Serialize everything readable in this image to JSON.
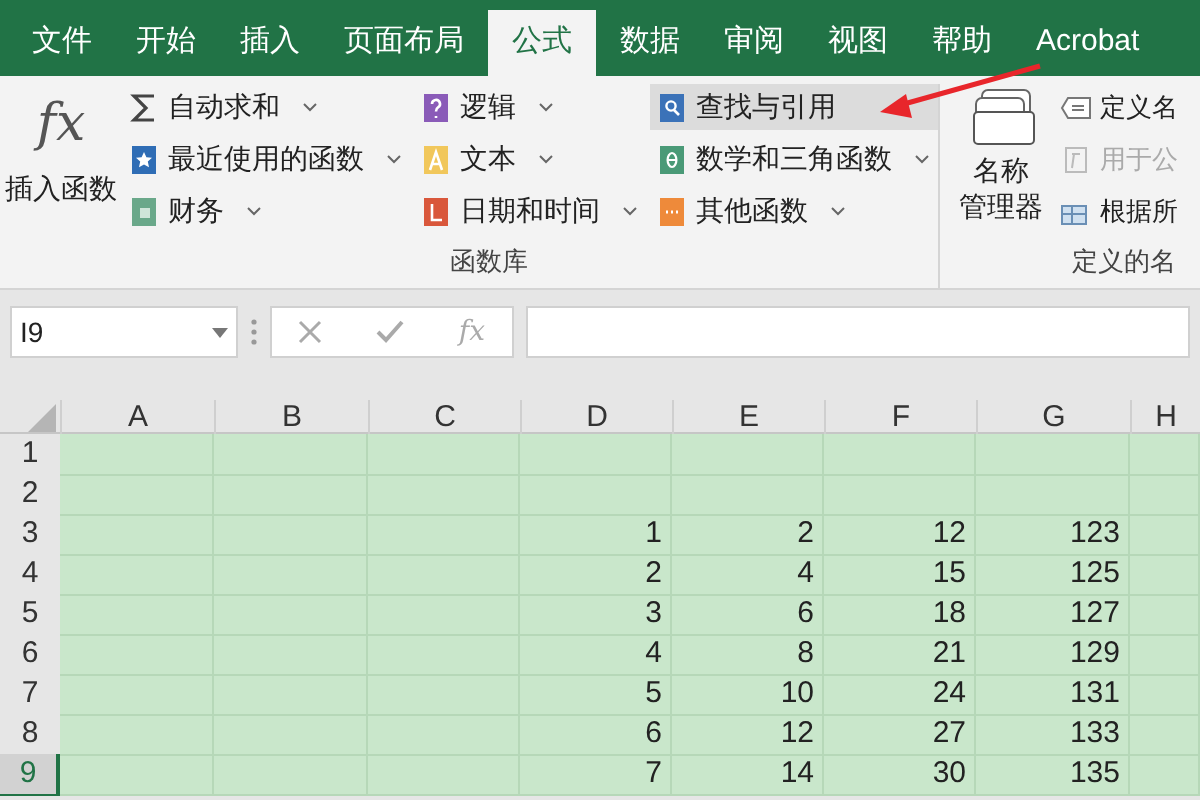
{
  "tabs": [
    {
      "label": "文件",
      "selected": false
    },
    {
      "label": "开始",
      "selected": false
    },
    {
      "label": "插入",
      "selected": false
    },
    {
      "label": "页面布局",
      "selected": false
    },
    {
      "label": "公式",
      "selected": true
    },
    {
      "label": "数据",
      "selected": false
    },
    {
      "label": "审阅",
      "selected": false
    },
    {
      "label": "视图",
      "selected": false
    },
    {
      "label": "帮助",
      "selected": false
    },
    {
      "label": "Acrobat",
      "selected": false
    }
  ],
  "function_library": {
    "label": "函数库",
    "insert_function": {
      "symbol": "fx",
      "label": "插入函数"
    },
    "commands": [
      {
        "label": "自动求和",
        "dropdown": true,
        "selected": false
      },
      {
        "label": "最近使用的函数",
        "dropdown": true,
        "selected": false
      },
      {
        "label": "财务",
        "dropdown": true,
        "selected": false
      },
      {
        "label": "逻辑",
        "dropdown": true,
        "selected": false
      },
      {
        "label": "文本",
        "dropdown": true,
        "selected": false
      },
      {
        "label": "日期和时间",
        "dropdown": true,
        "selected": false
      },
      {
        "label": "查找与引用",
        "dropdown": false,
        "selected": true
      },
      {
        "label": "数学和三角函数",
        "dropdown": true,
        "selected": false
      },
      {
        "label": "其他函数",
        "dropdown": true,
        "selected": false
      }
    ]
  },
  "defined_names": {
    "label": "定义的名",
    "name_manager": "名称管理器",
    "commands": [
      {
        "label": "定义名",
        "disabled": false
      },
      {
        "label": "用于公",
        "disabled": true
      },
      {
        "label": "根据所",
        "disabled": false
      }
    ]
  },
  "formula_bar": {
    "name_box": "I9",
    "fx": "fx"
  },
  "columns": [
    "A",
    "B",
    "C",
    "D",
    "E",
    "F",
    "G",
    "H"
  ],
  "rows": [
    {
      "number": "1",
      "selected": false,
      "cells": [
        null,
        null,
        null,
        null,
        null,
        null,
        null,
        null
      ]
    },
    {
      "number": "2",
      "selected": false,
      "cells": [
        null,
        null,
        null,
        null,
        null,
        null,
        null,
        null
      ]
    },
    {
      "number": "3",
      "selected": false,
      "cells": [
        null,
        null,
        null,
        "1",
        "2",
        "12",
        "123",
        null
      ]
    },
    {
      "number": "4",
      "selected": false,
      "cells": [
        null,
        null,
        null,
        "2",
        "4",
        "15",
        "125",
        null
      ]
    },
    {
      "number": "5",
      "selected": false,
      "cells": [
        null,
        null,
        null,
        "3",
        "6",
        "18",
        "127",
        null
      ]
    },
    {
      "number": "6",
      "selected": false,
      "cells": [
        null,
        null,
        null,
        "4",
        "8",
        "21",
        "129",
        null
      ]
    },
    {
      "number": "7",
      "selected": false,
      "cells": [
        null,
        null,
        null,
        "5",
        "10",
        "24",
        "131",
        null
      ]
    },
    {
      "number": "8",
      "selected": false,
      "cells": [
        null,
        null,
        null,
        "6",
        "12",
        "27",
        "133",
        null
      ]
    },
    {
      "number": "9",
      "selected": true,
      "cells": [
        null,
        null,
        null,
        "7",
        "14",
        "30",
        "135",
        null
      ]
    }
  ]
}
